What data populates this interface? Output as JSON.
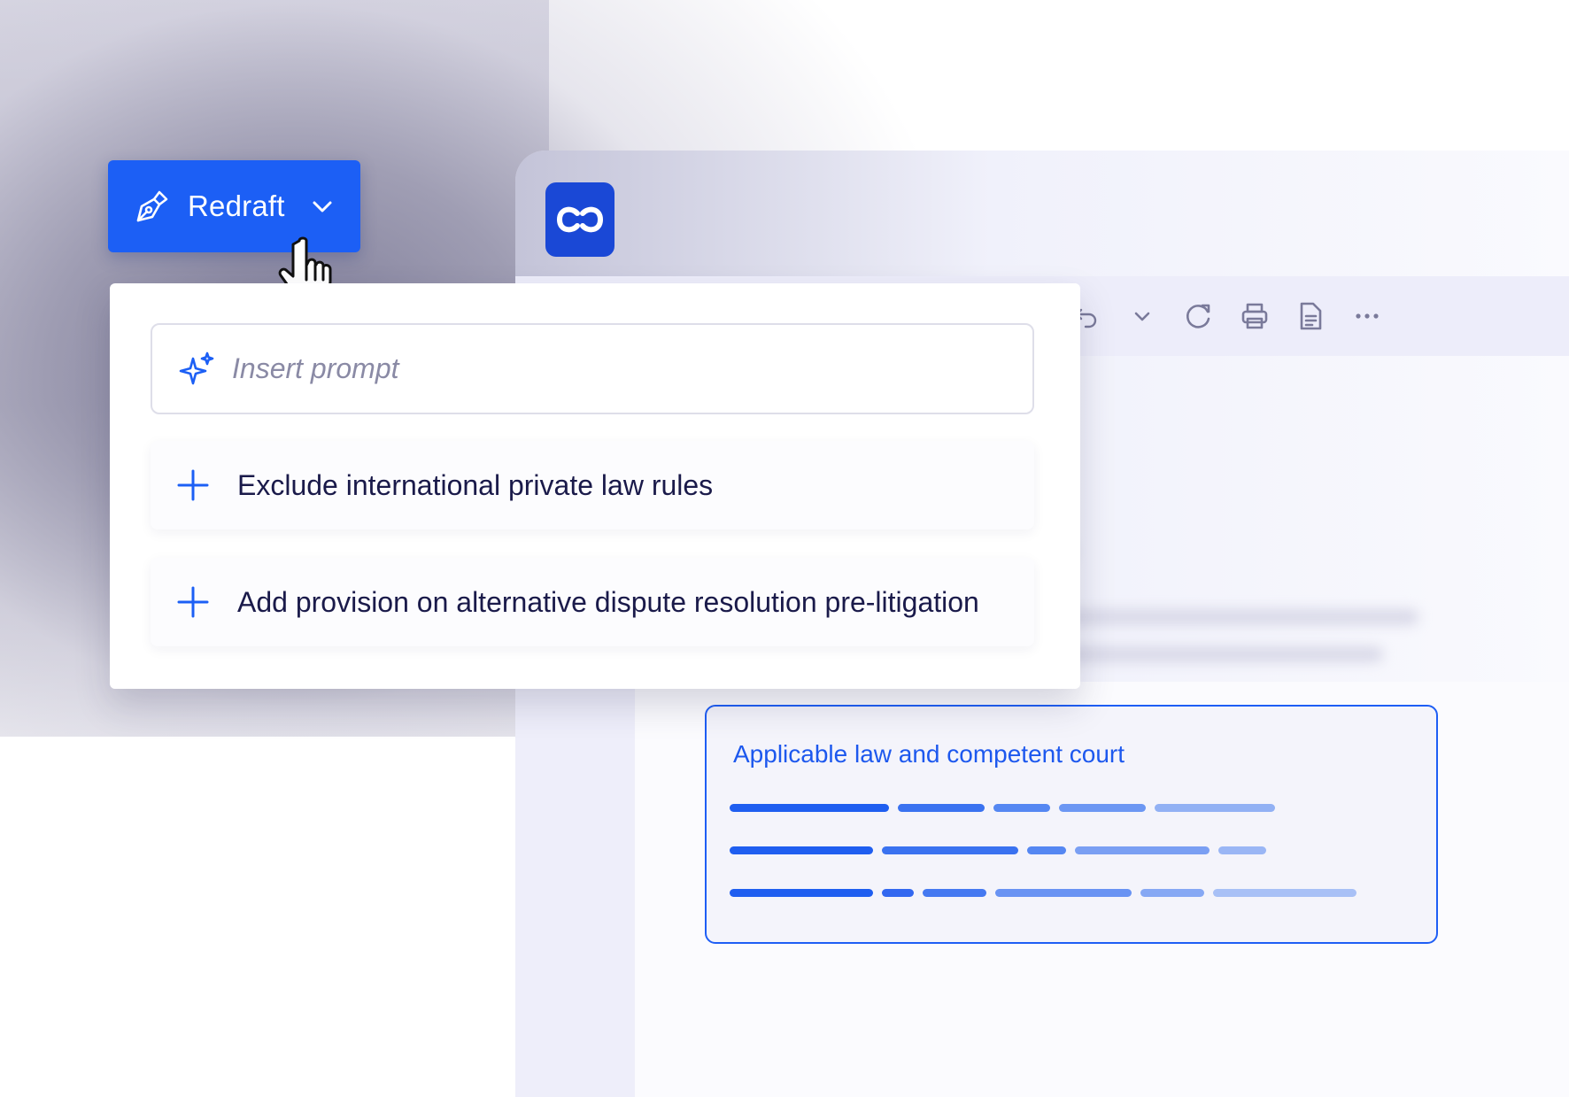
{
  "redraft": {
    "label": "Redraft",
    "pen_icon": "pen-nib-icon",
    "chevron_icon": "chevron-down-icon"
  },
  "prompt": {
    "placeholder": "Insert prompt",
    "icon": "sparkle-icon"
  },
  "suggestions": [
    {
      "label": "Exclude international private law rules",
      "icon": "plus-icon"
    },
    {
      "label": "Add provision on alternative dispute resolution pre-litigation",
      "icon": "plus-icon"
    }
  ],
  "app": {
    "logo_icon": "infinity-link-logo",
    "toolbar_icons": [
      "undo-icon",
      "chevron-down-icon",
      "refresh-icon",
      "print-icon",
      "document-icon",
      "more-icon"
    ]
  },
  "clause": {
    "title": "Applicable law and competent court"
  },
  "colors": {
    "accent": "#1c5ff5",
    "logo_bg": "#1a48d6",
    "text_dark": "#1a1a4a",
    "clause_border": "#1e5ef5"
  }
}
